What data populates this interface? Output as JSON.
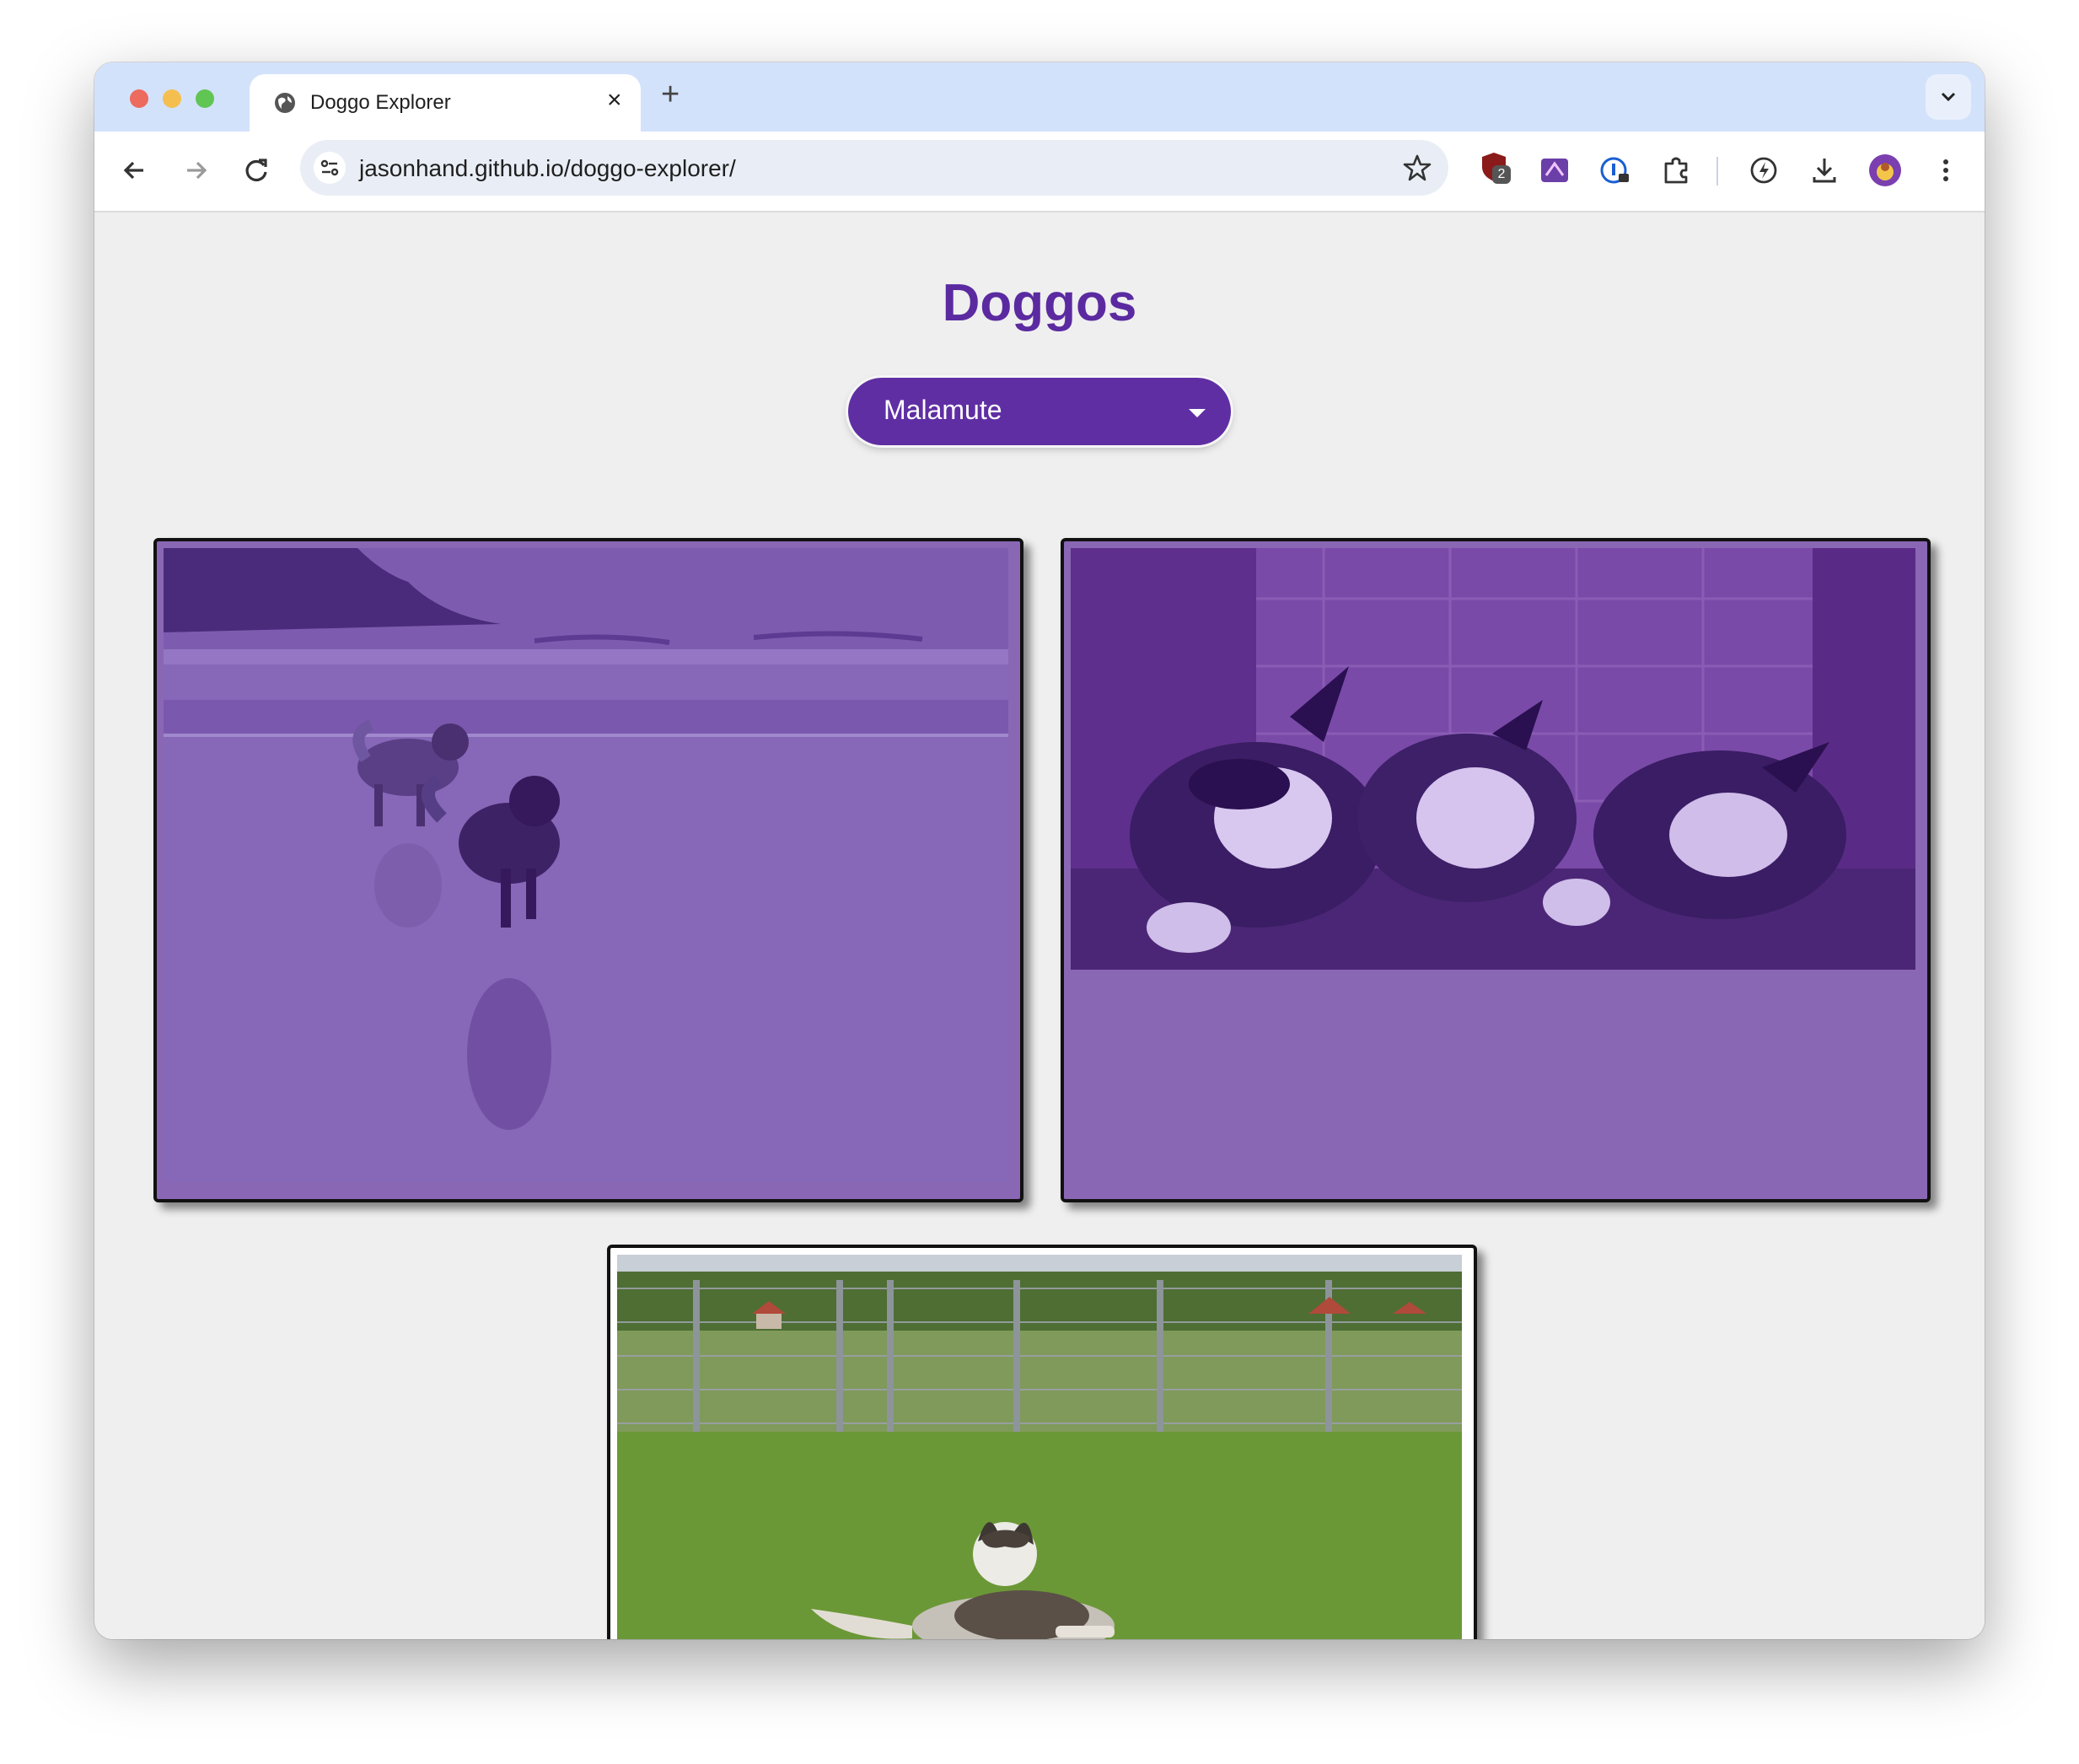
{
  "browser": {
    "tab_title": "Doggo Explorer",
    "url_host": "jasonhand.github.io",
    "url_path": "/doggo-explorer/",
    "extension_badge": "2"
  },
  "page": {
    "title": "Doggos",
    "breed_select": {
      "selected": "Malamute"
    }
  },
  "gallery": {
    "images": [
      {
        "subject": "two malamutes running on a beach",
        "overlay_color": "#7a52b3"
      },
      {
        "subject": "three malamute puppies resting",
        "overlay_color": "#6a3a9e"
      },
      {
        "subject": "malamute lying on grass in a fenced field"
      }
    ]
  }
}
